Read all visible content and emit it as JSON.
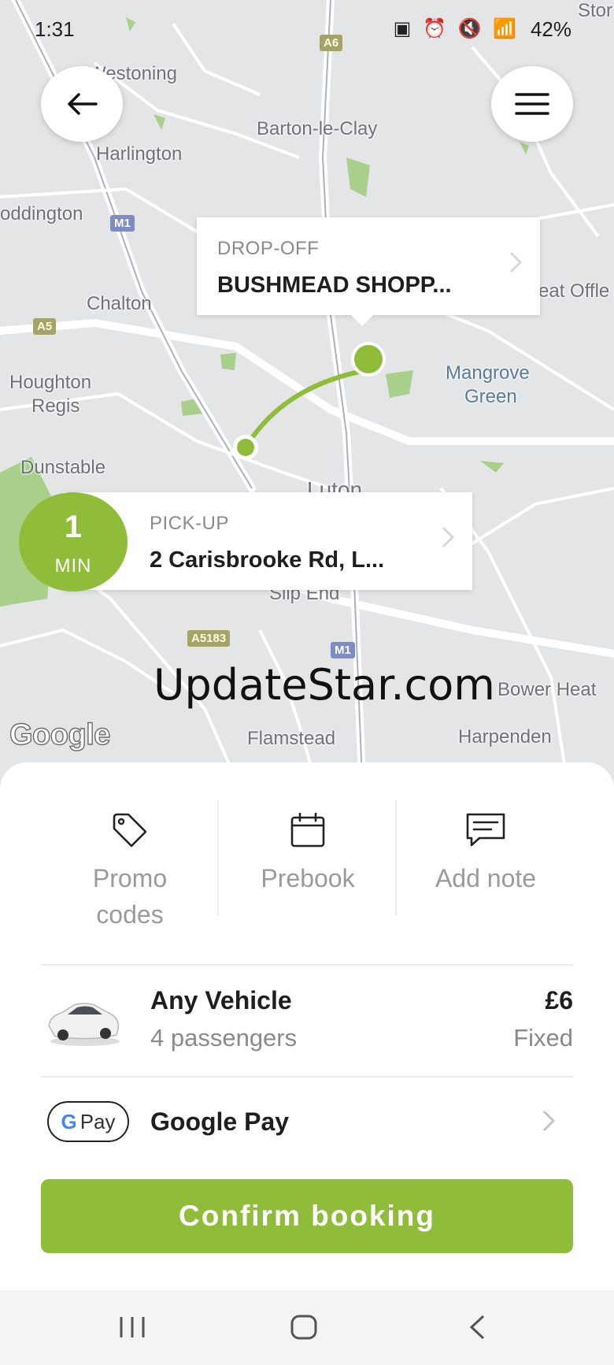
{
  "status_bar": {
    "time": "1:31",
    "icons": "▣ ⏰ 🔇 📶",
    "battery": "42%"
  },
  "map": {
    "places": [
      {
        "name": "Westoning"
      },
      {
        "name": "Barton-le-Clay"
      },
      {
        "name": "Harlington"
      },
      {
        "name": "oddington"
      },
      {
        "name": "Chalton"
      },
      {
        "name": "Houghton"
      },
      {
        "name": "Regis"
      },
      {
        "name": "Dunstable"
      },
      {
        "name": "Mangrove"
      },
      {
        "name": "Green"
      },
      {
        "name": "Luton"
      },
      {
        "name": "Slip End"
      },
      {
        "name": "Bower Heat"
      },
      {
        "name": "Harpenden"
      },
      {
        "name": "Flamstead"
      },
      {
        "name": "eat Offle"
      },
      {
        "name": "Stor"
      }
    ],
    "road_shields": [
      {
        "label": "A6",
        "kind": "a"
      },
      {
        "label": "M1",
        "kind": "m"
      },
      {
        "label": "A5",
        "kind": "a"
      },
      {
        "label": "A5183",
        "kind": "a"
      },
      {
        "label": "M1",
        "kind": "m"
      }
    ],
    "google_logo": "Google",
    "watermark": "UpdateStar.com",
    "route_color": "#8fbd39"
  },
  "dropoff": {
    "kicker": "DROP-OFF",
    "address": "BUSHMEAD SHOPP..."
  },
  "pickup": {
    "kicker": "PICK-UP",
    "address": "2 Carisbrooke Rd, L...",
    "eta_value": "1",
    "eta_unit": "MIN"
  },
  "options": {
    "promo": {
      "line1": "Promo",
      "line2": "codes",
      "icon": "tag-icon"
    },
    "prebook": {
      "label": "Prebook",
      "icon": "calendar-icon"
    },
    "note": {
      "label": "Add note",
      "icon": "message-icon"
    }
  },
  "vehicle": {
    "name": "Any Vehicle",
    "passengers": "4 passengers",
    "price": "£6",
    "price_type": "Fixed",
    "icon": "car-icon"
  },
  "payment": {
    "badge_g": "G",
    "badge_text": "Pay",
    "name": "Google Pay"
  },
  "confirm_label": "Confirm booking",
  "colors": {
    "accent": "#8fbd39",
    "muted_text": "#9a9a9a",
    "dark_text": "#1e1e1e"
  }
}
